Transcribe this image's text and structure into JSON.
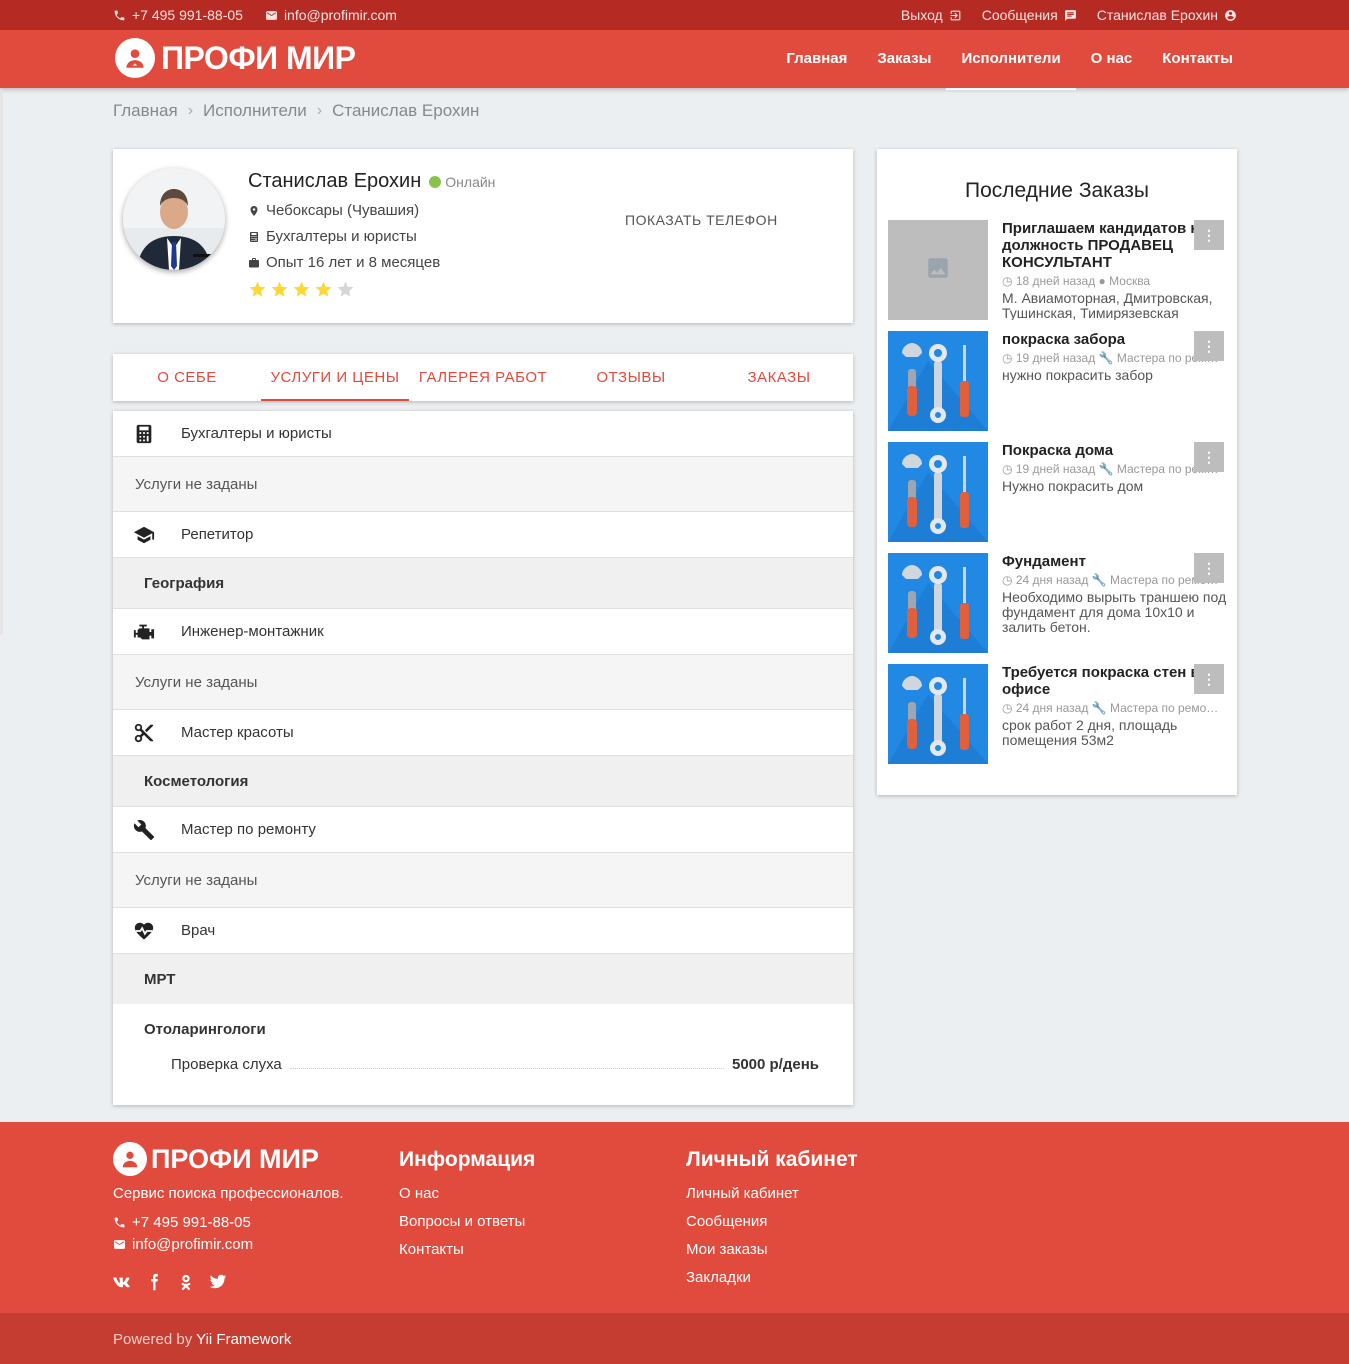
{
  "topbar": {
    "phone": "+7 495 991-88-05",
    "email": "info@profimir.com",
    "logout": "Выход",
    "messages": "Сообщения",
    "user": "Станислав Ерохин"
  },
  "header": {
    "logo": "ПРОФИ МИР",
    "nav": [
      "Главная",
      "Заказы",
      "Исполнители",
      "О нас",
      "Контакты"
    ],
    "active_nav": "Исполнители"
  },
  "breadcrumb": [
    "Главная",
    "Исполнители",
    "Станислав Ерохин"
  ],
  "profile": {
    "name": "Станислав Ерохин",
    "status": "Онлайн",
    "city": "Чебоксары (Чувашия)",
    "category": "Бухгалтеры и юристы",
    "experience": "Опыт 16 лет и 8 месяцев",
    "rating": 4,
    "rating_max": 5,
    "show_phone": "ПОКАЗАТЬ ТЕЛЕФОН"
  },
  "tabs": [
    "О СЕБЕ",
    "УСЛУГИ И ЦЕНЫ",
    "ГАЛЕРЕЯ РАБОТ",
    "ОТЗЫВЫ",
    "ЗАКАЗЫ"
  ],
  "active_tab": "УСЛУГИ И ЦЕНЫ",
  "services": {
    "cat1": "Бухгалтеры и юристы",
    "cat1_empty": "Услуги не заданы",
    "cat2": "Репетитор",
    "cat2_sub1": "География",
    "cat3": "Инженер-монтажник",
    "cat3_empty": "Услуги не заданы",
    "cat4": "Мастер красоты",
    "cat4_sub1": "Косметология",
    "cat5": "Мастер по ремонту",
    "cat5_empty": "Услуги не заданы",
    "cat6": "Врач",
    "cat6_sub1": "МРТ",
    "cat6_sub2": "Отоларингологи",
    "price_item": "Проверка слуха",
    "price_value": "5000 р/день"
  },
  "sidebar": {
    "title": "Последние Заказы",
    "orders": [
      {
        "title": "Приглашаем кандидатов на должность ПРОДАВЕЦ КОНСУЛЬТАНТ",
        "time": "18 дней назад",
        "place": "Москва",
        "desc": "М. Авиамоторная, Дмитровская, Тушинская, Тимирязевская"
      },
      {
        "title": "покраска забора",
        "time": "19 дней назад",
        "place": "Мастера по ремонту",
        "desc": "нужно покрасить забор"
      },
      {
        "title": "Покраска дома",
        "time": "19 дней назад",
        "place": "Мастера по ремонту",
        "desc": "Нужно покрасить дом"
      },
      {
        "title": "Фундамент",
        "time": "24 дня назад",
        "place": "Мастера по ремонту",
        "desc": "Необходимо вырыть траншею под фундамент для дома 10х10 и залить бетон."
      },
      {
        "title": "Требуется покраска стен в офисе",
        "time": "24 дня назад",
        "place": "Мастера по ремонту",
        "desc": "срок работ 2 дня, площадь помещения 53м2"
      }
    ]
  },
  "footer": {
    "logo": "ПРОФИ МИР",
    "slogan": "Сервис поиска профессионалов.",
    "phone": "+7 495 991-88-05",
    "email": "info@profimir.com",
    "socials": [
      "vk",
      "facebook",
      "odnoklassniki",
      "twitter"
    ],
    "info_title": "Информация",
    "info_links": [
      "О нас",
      "Вопросы и ответы",
      "Контакты"
    ],
    "cabinet_title": "Личный кабинет",
    "cabinet_links": [
      "Личный кабинет",
      "Сообщения",
      "Мои заказы",
      "Закладки"
    ],
    "powered": "Powered by",
    "framework": "Yii Framework"
  },
  "colors": {
    "brand": "#e04b3e",
    "topbar": "#b52a22",
    "star": "#fdd835",
    "online": "#8bc34a",
    "order_thumb": "#2188e4"
  }
}
